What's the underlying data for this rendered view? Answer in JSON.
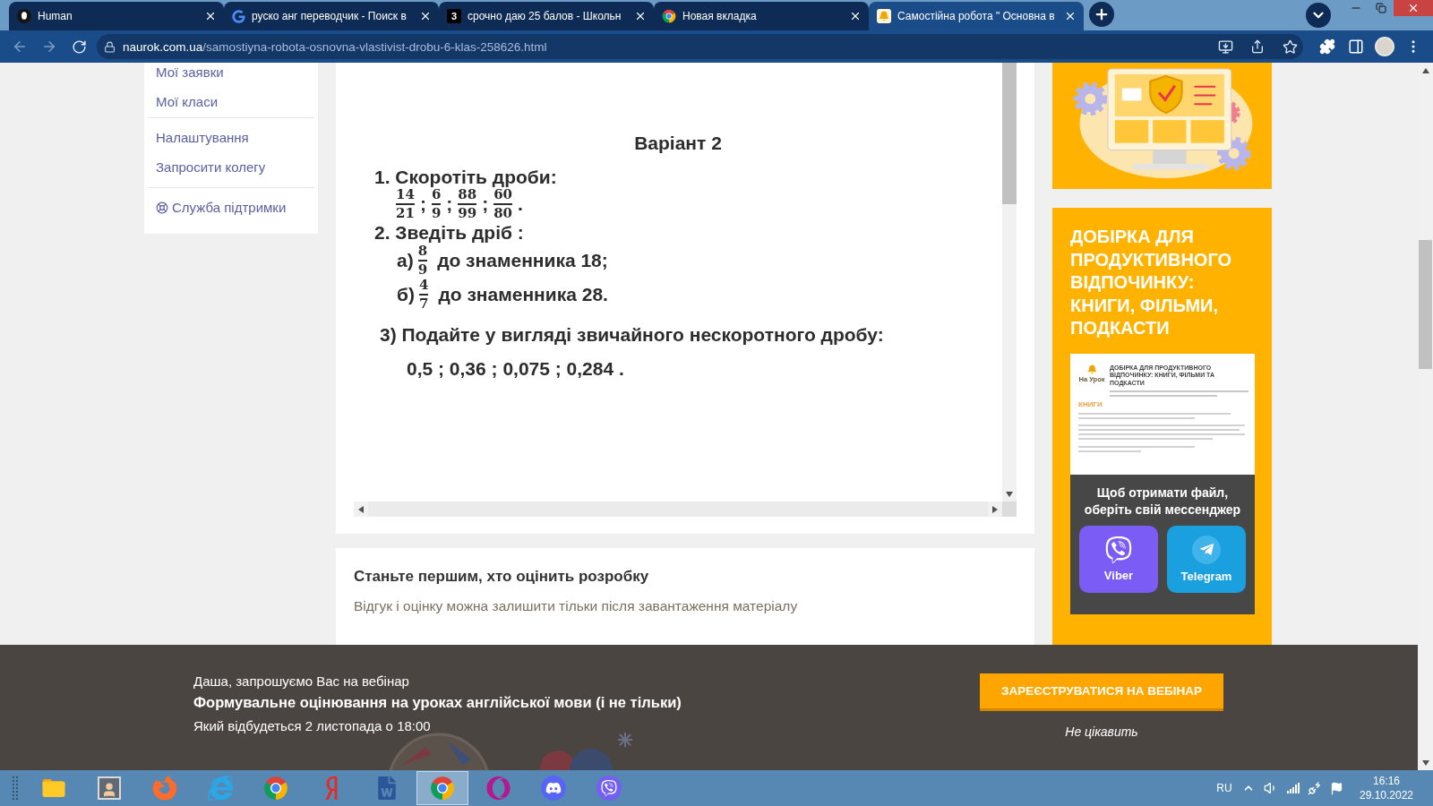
{
  "browser": {
    "tabs": [
      {
        "title": "Human",
        "kind": "round",
        "selected": false
      },
      {
        "title": "руско анг переводчик - Поиск в",
        "kind": "g",
        "selected": false
      },
      {
        "title": "срочно даю 25 балов - Школьн",
        "kind": "number",
        "badge": "3",
        "selected": false
      },
      {
        "title": "Новая вкладка",
        "kind": "wheel",
        "selected": false
      },
      {
        "title": "Самостійна робота \" Основна в",
        "kind": "bell",
        "selected": true
      }
    ],
    "url": {
      "domain": "naurok.com.ua",
      "path": "/samostiyna-robota-osnovna-vlastivist-drobu-6-klas-258626.html"
    }
  },
  "sidebar": {
    "groups": [
      [
        {
          "label": "Мої заявки",
          "kind": "link"
        },
        {
          "label": "Мої класи",
          "kind": "link"
        }
      ],
      [
        {
          "label": "Налаштування",
          "kind": "link"
        },
        {
          "label": "Запросити колегу",
          "kind": "link"
        }
      ],
      [
        {
          "label": "Служба підтримки",
          "kind": "support"
        }
      ]
    ]
  },
  "document": {
    "title": "Варіант 2",
    "tasks": [
      {
        "kind": "fractions",
        "heading": "1. Скоротіть дроби:",
        "fractions": [
          {
            "numerator": "14",
            "denominator": "21",
            "after": ";"
          },
          {
            "numerator": "6",
            "denominator": "9",
            "after": ";"
          },
          {
            "numerator": "88",
            "denominator": "99",
            "after": ";"
          },
          {
            "numerator": "60",
            "denominator": "80",
            "after": "."
          }
        ]
      },
      {
        "kind": "convert",
        "heading": "2. Зведіть дріб :",
        "items": [
          {
            "marker": "а)",
            "numerator": "8",
            "denominator": "9",
            "text": "до знаменника 18;"
          },
          {
            "marker": "б)",
            "numerator": "4",
            "denominator": "7",
            "text": "до знаменника 28."
          }
        ]
      },
      {
        "kind": "decimals",
        "heading": "3) Подайте у вигляді звичайного нескоротного дробу:",
        "text": "0,5 ; 0,36 ; 0,075 ; 0,284 ."
      }
    ]
  },
  "review": {
    "title": "Станьте першим, хто оцінить розробку",
    "note": "Відгук і оцінку можна залишити тільки після завантаження матеріалу"
  },
  "promo": {
    "title": "ДОБІРКА ДЛЯ ПРОДУКТИВНОГО ВІДПОЧИНКУ: КНИГИ, ФІЛЬМИ, ПОДКАСТИ",
    "preview": {
      "logo": "На Урок",
      "heading": "ДОБІРКА ДЛЯ ПРОДУКТИВНОГО ВІДПОЧИНКУ: КНИГИ, ФІЛЬМИ ТА ПОДКАСТИ",
      "section": "КНИГИ"
    },
    "prompt": "Щоб отримати файл, оберіть свій мессенджер",
    "messengers": [
      {
        "label": "Viber",
        "kind": "viber"
      },
      {
        "label": "Telegram",
        "kind": "telegram"
      }
    ]
  },
  "banner": {
    "invite": "Даша, запрошуємо Вас на вебінар",
    "title": "Формувальне оцінювання на уроках англійської мови (і не тільки)",
    "date": "Який відбудеться 2 листопада о 18:00",
    "button": "ЗАРЕЄСТРУВАТИСЯ НА ВЕБІНАР",
    "dismiss": "Не цікавить"
  },
  "taskbar": {
    "apps": [
      {
        "kind": "folder",
        "selected": false
      },
      {
        "kind": "contacts",
        "selected": false
      },
      {
        "kind": "firefox",
        "selected": false
      },
      {
        "kind": "ie",
        "selected": false
      },
      {
        "kind": "chrome",
        "selected": false
      },
      {
        "kind": "yandex",
        "selected": false
      },
      {
        "kind": "word",
        "selected": false
      },
      {
        "kind": "chrome",
        "selected": true
      },
      {
        "kind": "opera",
        "selected": false
      },
      {
        "kind": "discord",
        "selected": false
      },
      {
        "kind": "viber",
        "selected": false
      }
    ],
    "language": "RU",
    "time": "16:16",
    "date": "29.10.2022"
  }
}
